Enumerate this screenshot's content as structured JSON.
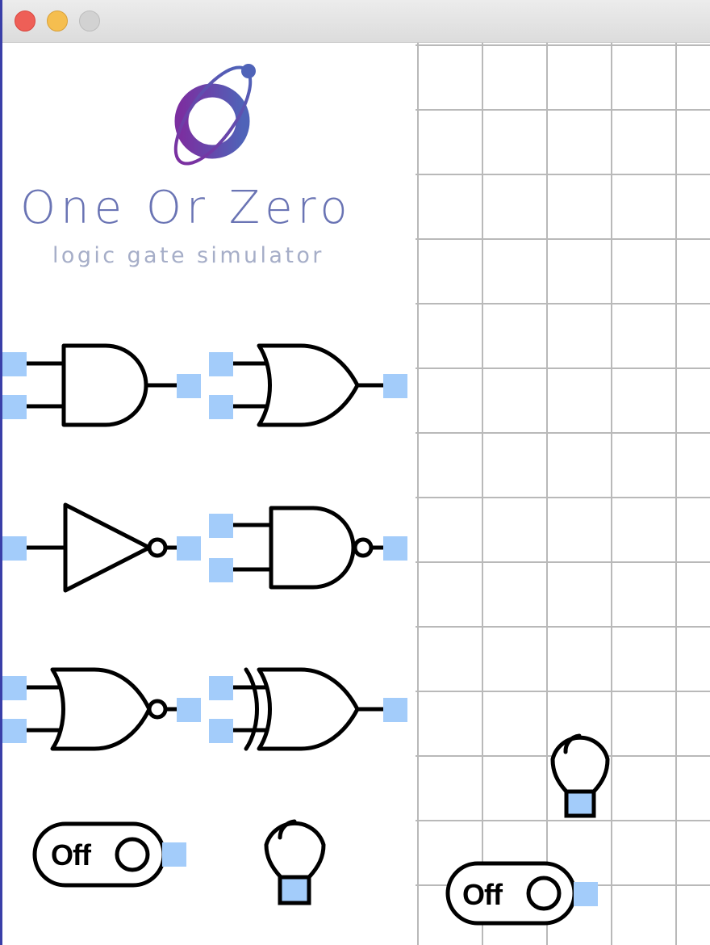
{
  "window": {
    "controls": [
      "close",
      "minimize",
      "maximize"
    ]
  },
  "brand": {
    "title": "One Or Zero",
    "subtitle": "logic gate simulator",
    "logo_icon": "planet-orbit-logo",
    "colors": {
      "title": "#6a74b4",
      "subtitle": "#a6aec8",
      "logo_start": "#7b2fa0",
      "logo_end": "#4f63b8"
    }
  },
  "palette": {
    "gates": [
      {
        "name": "and-gate",
        "type": "AND"
      },
      {
        "name": "or-gate",
        "type": "OR"
      },
      {
        "name": "not-gate",
        "type": "NOT"
      },
      {
        "name": "nand-gate",
        "type": "NAND"
      },
      {
        "name": "nor-gate",
        "type": "NOR"
      },
      {
        "name": "xor-gate",
        "type": "XOR"
      }
    ],
    "switch": {
      "label": "Off"
    },
    "bulb": {
      "icon": "light-bulb-icon"
    }
  },
  "canvas": {
    "grid": true,
    "switch": {
      "label": "Off"
    },
    "bulb": {
      "icon": "light-bulb-icon"
    }
  },
  "colors": {
    "pin": "#a3ccfa",
    "grid": "#b9b9b9",
    "stroke": "#000000"
  }
}
